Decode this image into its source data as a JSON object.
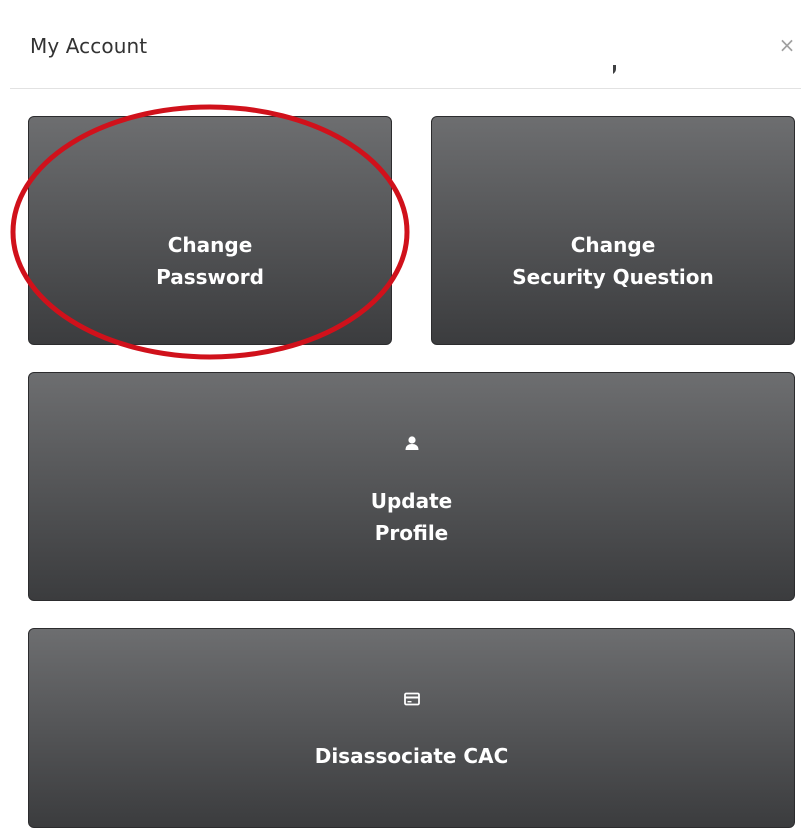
{
  "dialog": {
    "title": "My Account",
    "close_glyph": "×"
  },
  "tiles": [
    {
      "icon": "lock-icon",
      "label_line1": "Change",
      "label_line2": "Password"
    },
    {
      "icon": "shield-icon",
      "label_line1": "Change",
      "label_line2": "Security Question"
    },
    {
      "icon": "user-icon",
      "label_line1": "Update",
      "label_line2": "Profile"
    },
    {
      "icon": "card-icon",
      "label_line1": "Disassociate CAC"
    }
  ],
  "colors": {
    "tile_top": "#6d6e70",
    "tile_bottom": "#3b3c3e",
    "annotation": "#d0111b"
  }
}
